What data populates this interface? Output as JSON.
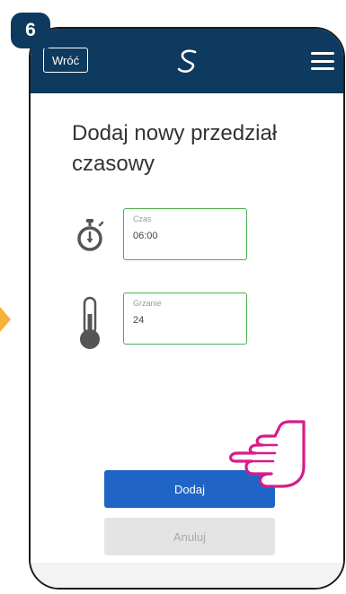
{
  "step": {
    "number": "6"
  },
  "header": {
    "back_label": "Wróć",
    "logo_icon": "brand-s-logo-icon",
    "menu_icon": "hamburger-menu-icon"
  },
  "page": {
    "title": "Dodaj nowy przedział czasowy"
  },
  "fields": {
    "time": {
      "icon": "stopwatch-icon",
      "label": "Czas",
      "value": "06:00"
    },
    "heating": {
      "icon": "thermometer-icon",
      "label": "Grzanie",
      "value": "24"
    }
  },
  "actions": {
    "add_label": "Dodaj",
    "cancel_label": "Anuluj"
  },
  "overlay": {
    "pointer_icon": "hand-pointer-icon",
    "arrow_icon": "arrow-right-icon"
  },
  "colors": {
    "header": "#0f3a5f",
    "field_border": "#4caf50",
    "primary_button": "#2065c6",
    "pointer": "#d81b8a",
    "arrow": "#f7b236"
  }
}
